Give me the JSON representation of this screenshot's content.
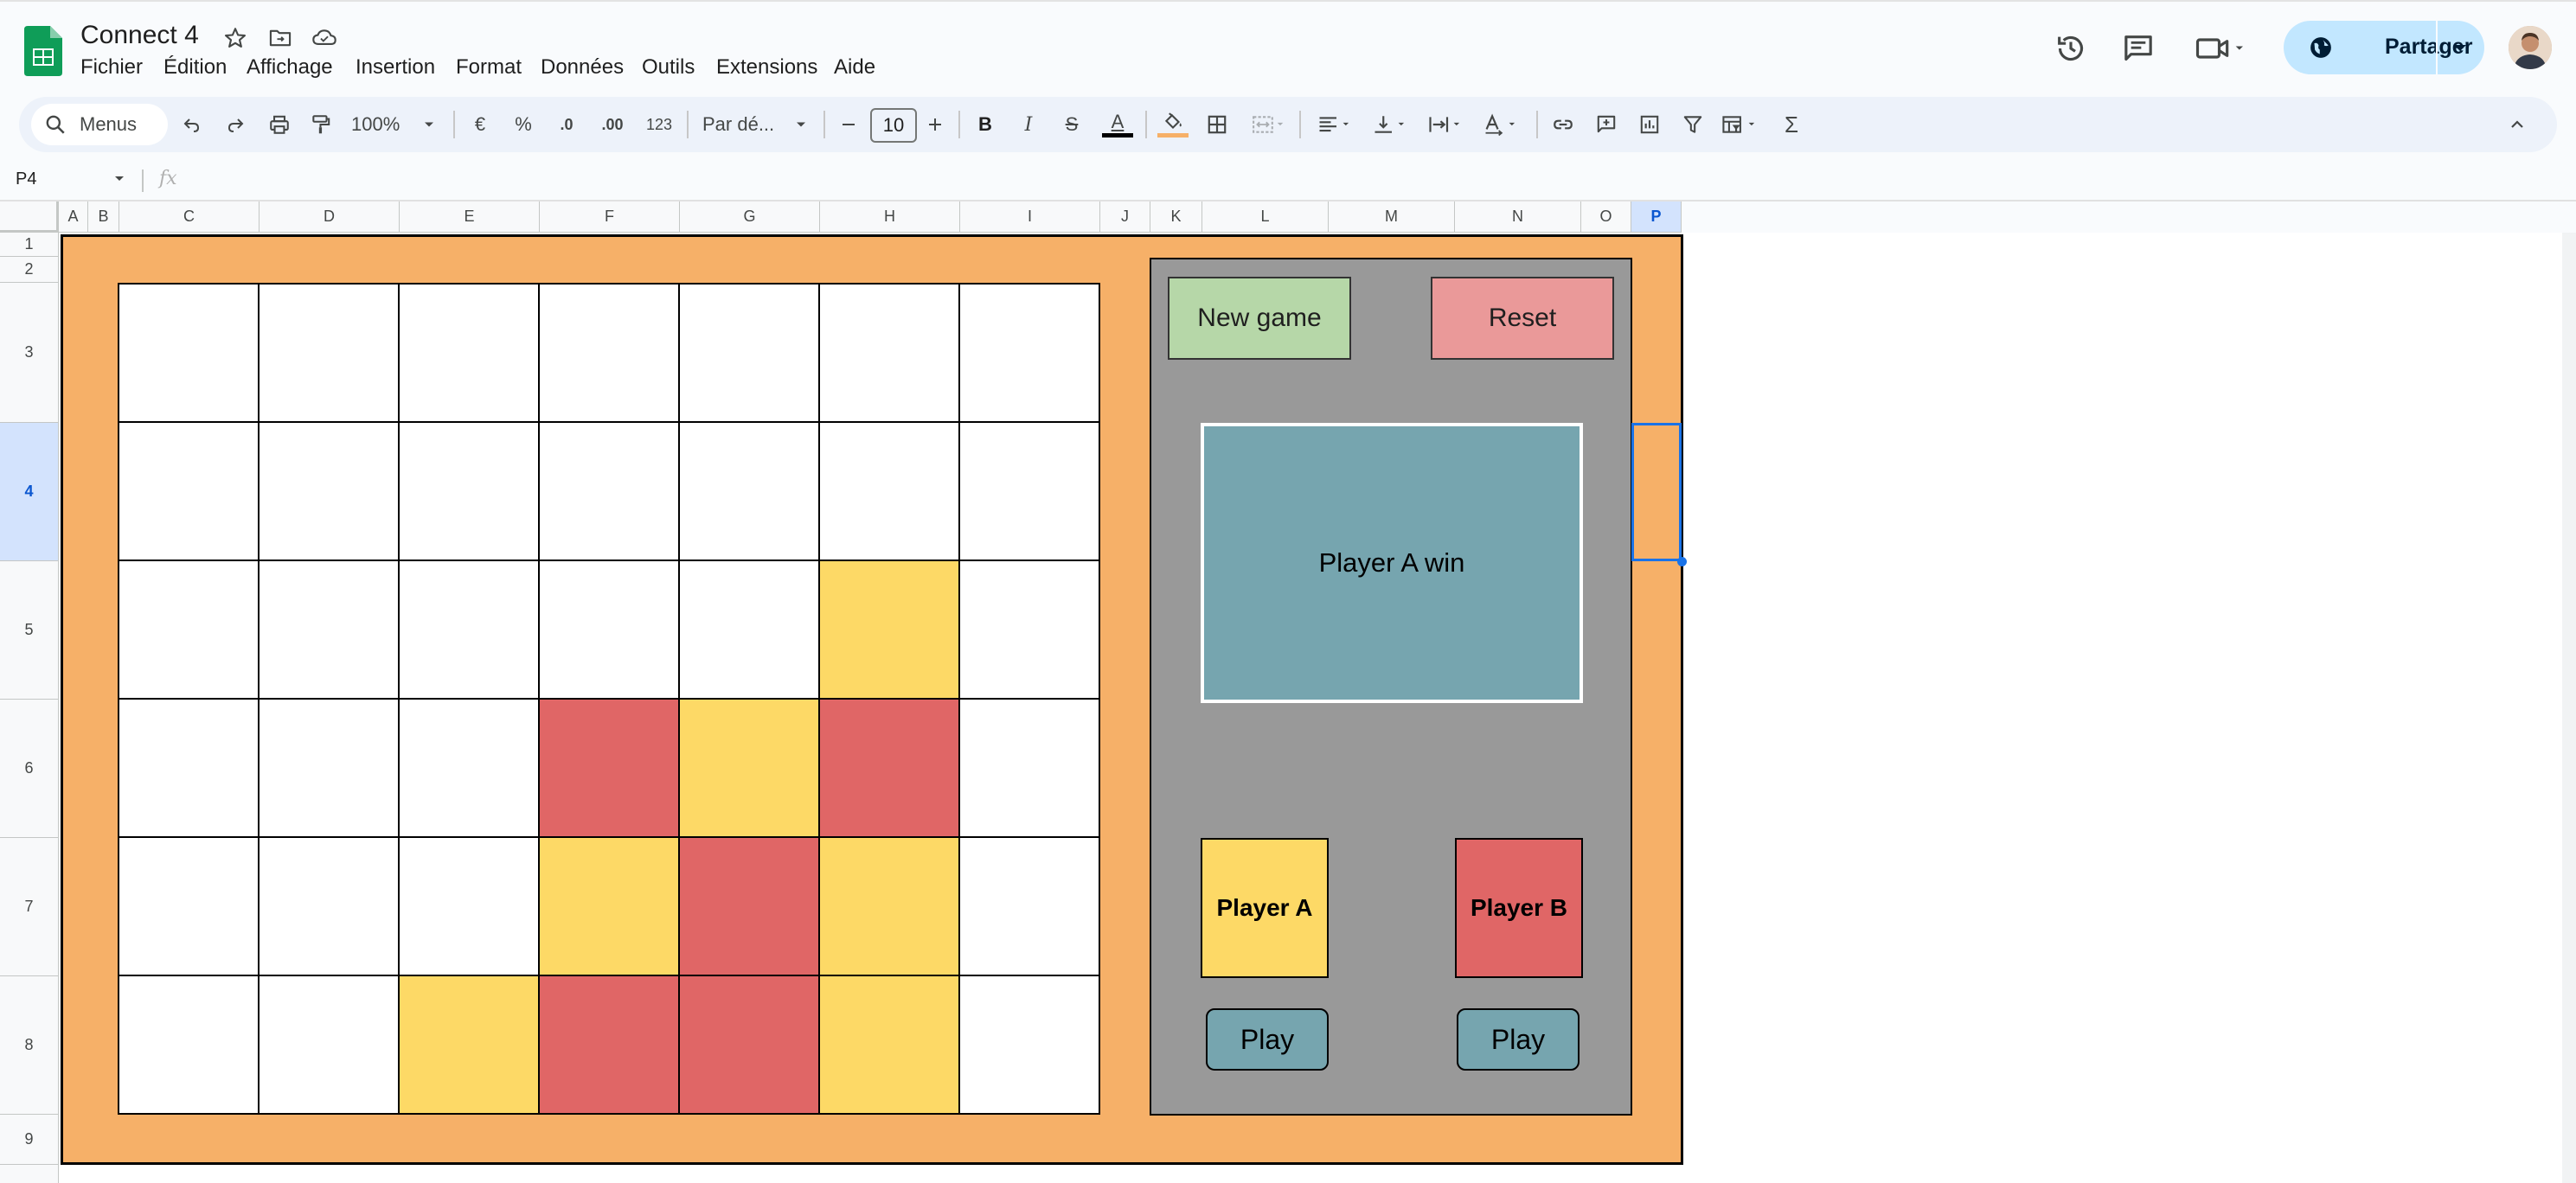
{
  "app": {
    "title": "Connect 4",
    "menu": [
      "Fichier",
      "Édition",
      "Affichage",
      "Insertion",
      "Format",
      "Données",
      "Outils",
      "Extensions",
      "Aide"
    ],
    "share_label": "Partager"
  },
  "toolbar": {
    "search_label": "Menus",
    "zoom": "100%",
    "currency": "€",
    "percent": "%",
    "dec_decrease": ".0",
    "dec_increase": ".00",
    "number_format": "123",
    "font": "Par dé...",
    "font_size": "10",
    "bold": "B",
    "italic": "I",
    "strike": "S",
    "text_color_letter": "A",
    "sum": "Σ"
  },
  "formula_bar": {
    "cell_ref": "P4",
    "fx": "fx"
  },
  "grid": {
    "columns": [
      "A",
      "B",
      "C",
      "D",
      "E",
      "F",
      "G",
      "H",
      "I",
      "J",
      "K",
      "L",
      "M",
      "N",
      "O",
      "P"
    ],
    "rows": [
      "1",
      "2",
      "3",
      "4",
      "5",
      "6",
      "7",
      "8",
      "9"
    ],
    "selected_column": "P",
    "selected_row": "4"
  },
  "board": {
    "rows": [
      [
        "empty",
        "empty",
        "empty",
        "empty",
        "empty",
        "empty",
        "empty"
      ],
      [
        "empty",
        "empty",
        "empty",
        "empty",
        "empty",
        "empty",
        "empty"
      ],
      [
        "empty",
        "empty",
        "empty",
        "empty",
        "empty",
        "yellow",
        "empty"
      ],
      [
        "empty",
        "empty",
        "empty",
        "red",
        "yellow",
        "red",
        "empty"
      ],
      [
        "empty",
        "empty",
        "empty",
        "yellow",
        "red",
        "yellow",
        "empty"
      ],
      [
        "empty",
        "empty",
        "yellow",
        "red",
        "red",
        "yellow",
        "empty"
      ]
    ],
    "colors": {
      "yellow": "#fdd966",
      "red": "#e06666",
      "empty": "#ffffff",
      "frame": "#f6b068",
      "panel": "#999999"
    }
  },
  "panel": {
    "new_game": "New game",
    "reset": "Reset",
    "status": "Player A win",
    "player_a": "Player A",
    "player_b": "Player B",
    "play_a": "Play",
    "play_b": "Play"
  }
}
